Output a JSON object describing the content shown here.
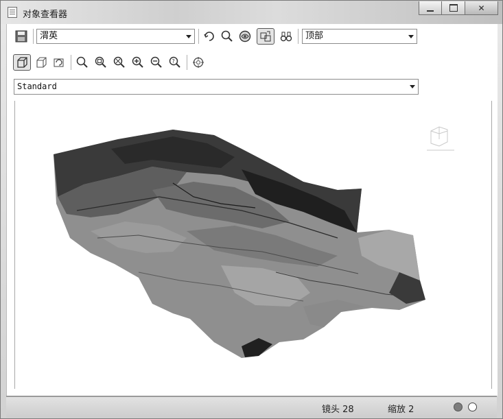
{
  "window": {
    "title": "对象查看器"
  },
  "toolbar1": {
    "layer_select": "渭英",
    "view_select": "顶部"
  },
  "toolbar2": {
    "style_select": "Standard"
  },
  "status": {
    "camera": "镜头 28",
    "zoom": "缩放 2"
  },
  "icons": {
    "save": "save-icon",
    "navigate": "navigate-icon",
    "orbit": "orbit-icon",
    "globe": "globe-icon",
    "swap": "swap-icon",
    "binoculars": "binoculars-icon",
    "view3d": "cube-icon",
    "reset": "reset-view-icon",
    "zoom": "zoom-icons",
    "target": "target-icon"
  }
}
